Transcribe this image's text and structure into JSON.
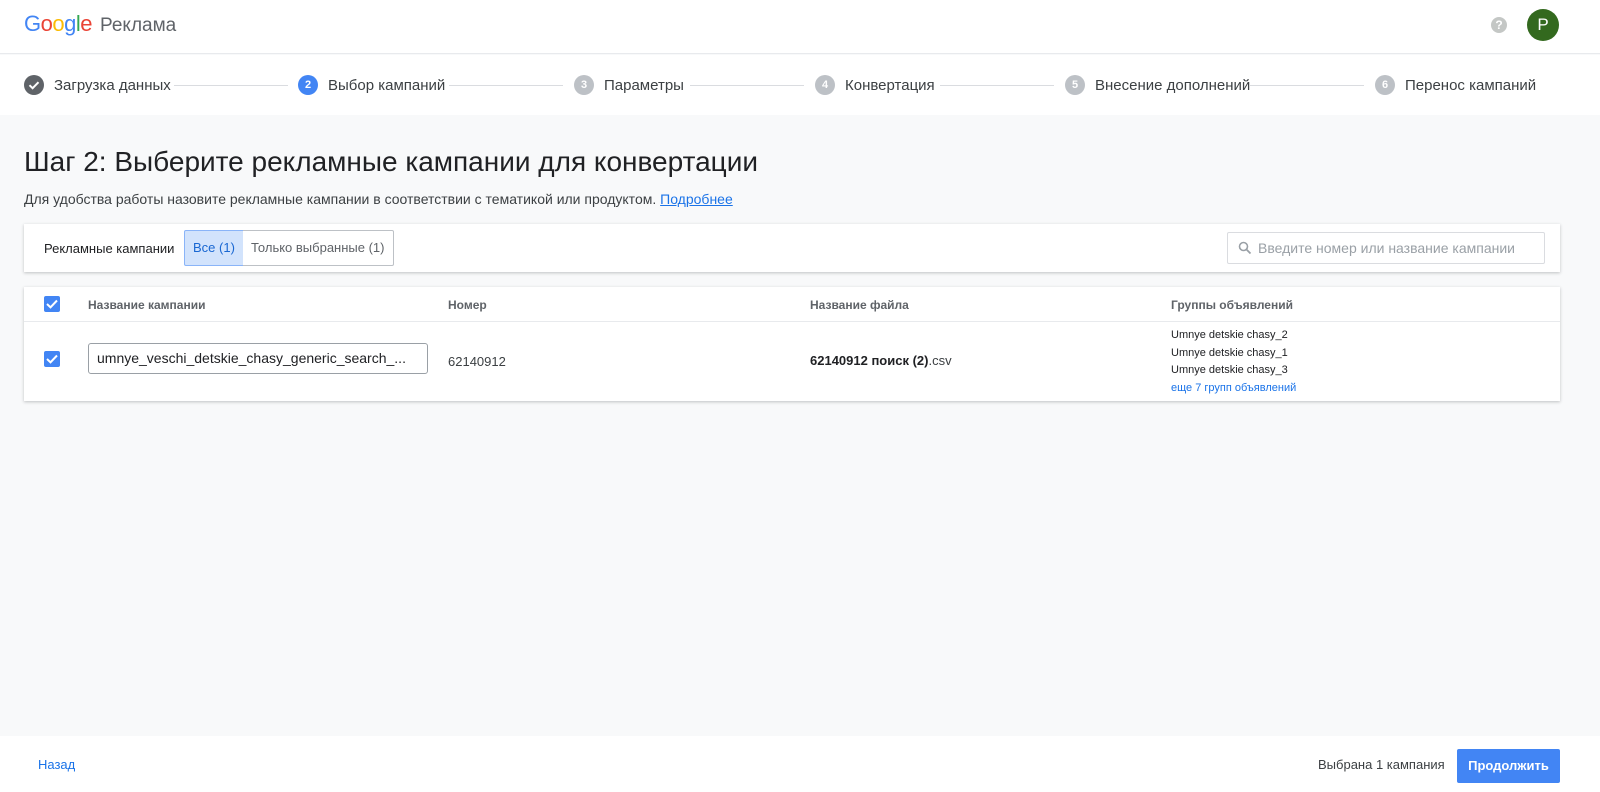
{
  "header": {
    "logo_letters": [
      {
        "ch": "G",
        "color": "#4285F4"
      },
      {
        "ch": "o",
        "color": "#EA4335"
      },
      {
        "ch": "o",
        "color": "#FBBC05"
      },
      {
        "ch": "g",
        "color": "#4285F4"
      },
      {
        "ch": "l",
        "color": "#34A853"
      },
      {
        "ch": "e",
        "color": "#EA4335"
      }
    ],
    "product": "Реклама",
    "help_glyph": "?",
    "avatar_letter": "P",
    "avatar_color": "#33691e"
  },
  "stepper": {
    "steps": [
      {
        "num": "",
        "label": "Загрузка данных",
        "state": "done"
      },
      {
        "num": "2",
        "label": "Выбор кампаний",
        "state": "active"
      },
      {
        "num": "3",
        "label": "Параметры",
        "state": "pending"
      },
      {
        "num": "4",
        "label": "Конвертация",
        "state": "pending"
      },
      {
        "num": "5",
        "label": "Внесение дополнений",
        "state": "pending"
      },
      {
        "num": "6",
        "label": "Перенос кампаний",
        "state": "pending"
      }
    ]
  },
  "page": {
    "title": "Шаг 2: Выберите рекламные кампании для конвертации",
    "description": "Для удобства работы назовите рекламные кампании в соответствии с тематикой или продуктом.",
    "more_link": "Подробнее"
  },
  "filter": {
    "label": "Рекламные кампании",
    "all_tab": "Все (1)",
    "selected_tab": "Только выбранные (1)",
    "search_placeholder": "Введите номер или название кампании"
  },
  "table": {
    "columns": {
      "name": "Название кампании",
      "number": "Номер",
      "file": "Название файла",
      "groups": "Группы объявлений"
    },
    "row": {
      "checked": true,
      "name": "umnye_veschi_detskie_chasy_generic_search_...",
      "number": "62140912",
      "file_bold": "62140912 поиск (2)",
      "file_ext": ".csv",
      "groups": [
        "Umnye detskie chasy_2",
        "Umnye detskie chasy_1",
        "Umnye detskie chasy_3"
      ],
      "more_groups": "еще 7 групп объявлений"
    }
  },
  "footer": {
    "back": "Назад",
    "selected_count": "Выбрана 1 кампания",
    "continue": "Продолжить"
  },
  "colors": {
    "accent": "#4285f4",
    "link": "#1a73e8"
  }
}
